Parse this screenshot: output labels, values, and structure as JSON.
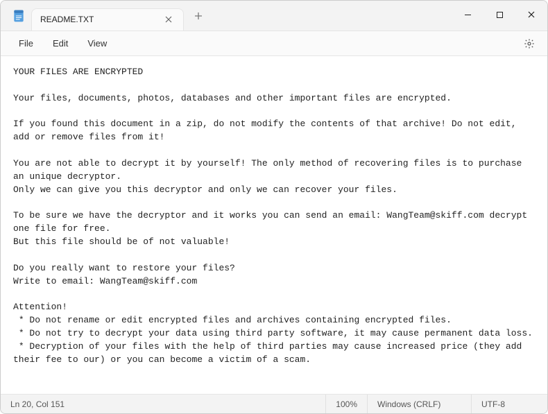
{
  "tab": {
    "title": "README.TXT"
  },
  "menu": {
    "file": "File",
    "edit": "Edit",
    "view": "View"
  },
  "content": "YOUR FILES ARE ENCRYPTED\n\nYour files, documents, photos, databases and other important files are encrypted.\n\nIf you found this document in a zip, do not modify the contents of that archive! Do not edit, add or remove files from it!\n\nYou are not able to decrypt it by yourself! The only method of recovering files is to purchase an unique decryptor.\nOnly we can give you this decryptor and only we can recover your files.\n\nTo be sure we have the decryptor and it works you can send an email: WangTeam@skiff.com decrypt one file for free.\nBut this file should be of not valuable!\n\nDo you really want to restore your files?\nWrite to email: WangTeam@skiff.com\n\nAttention!\n * Do not rename or edit encrypted files and archives containing encrypted files.\n * Do not try to decrypt your data using third party software, it may cause permanent data loss.\n * Decryption of your files with the help of third parties may cause increased price (they add their fee to our) or you can become a victim of a scam.",
  "status": {
    "position": "Ln 20, Col 151",
    "zoom": "100%",
    "line_ending": "Windows (CRLF)",
    "encoding": "UTF-8"
  }
}
